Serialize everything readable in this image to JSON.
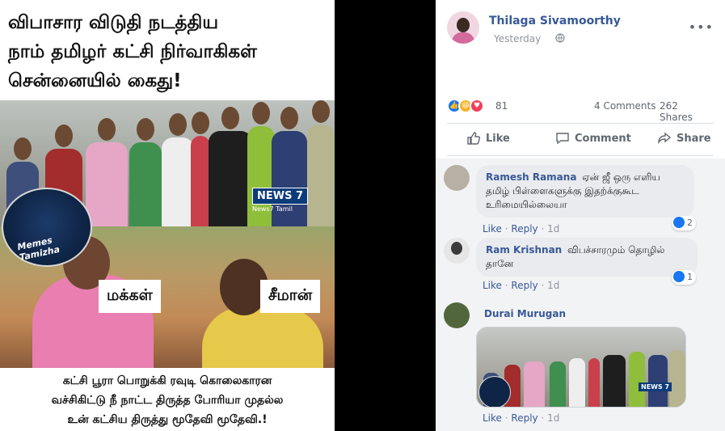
{
  "meme": {
    "headline": [
      "விபாசார விடுதி நடத்திய",
      "நாம் தமிழர் கட்சி நிர்வாகிகள்",
      "சென்னையில் கைது!"
    ],
    "channel_logo": "NEWS 7",
    "channel_sub": "News7 Tamil",
    "page_logo": "Memes Tamizha",
    "label_left": "மக்கள்",
    "label_right": "சீமான்",
    "caption": [
      "கட்சி பூரா பொறுக்கி ரவுடி கொலைகாரன",
      "வச்சிகிட்டு நீ நாட்ட திருத்த போரியா முதல்ல",
      "உன் கட்சிய திருத்து மூதேவி மூதேவி.!"
    ]
  },
  "post": {
    "author": "Thilaga Sivamoorthy",
    "timestamp": "Yesterday",
    "more_icon": "more-options-icon",
    "reaction_count": "81",
    "comments_count": "4 Comments",
    "shares_count": "262 Shares",
    "actions": {
      "like": "Like",
      "comment": "Comment",
      "share": "Share"
    },
    "colors": {
      "link": "#385898",
      "like": "#1877f2",
      "haha": "#f7b125",
      "love": "#f33e58"
    }
  },
  "comments": [
    {
      "name": "Ramesh Ramana",
      "text": "ஏன் ஜீ ஒரு எளிய",
      "text2": "தமிழ் பிள்ளைகளுக்கு இதற்க்குகூட",
      "text3": "உரிமையில்லையா",
      "like": "Like",
      "reply": "Reply",
      "time": "1d",
      "reacts": "2"
    },
    {
      "name": "Ram Krishnan",
      "text": "விபச்சாரமும் தொழில்",
      "text2": "தானே",
      "like": "Like",
      "reply": "Reply",
      "time": "1d",
      "reacts": "1"
    },
    {
      "name": "Durai Murugan",
      "like": "Like",
      "reply": "Reply",
      "time": "1d",
      "thumb_logo": "NEWS 7"
    }
  ]
}
